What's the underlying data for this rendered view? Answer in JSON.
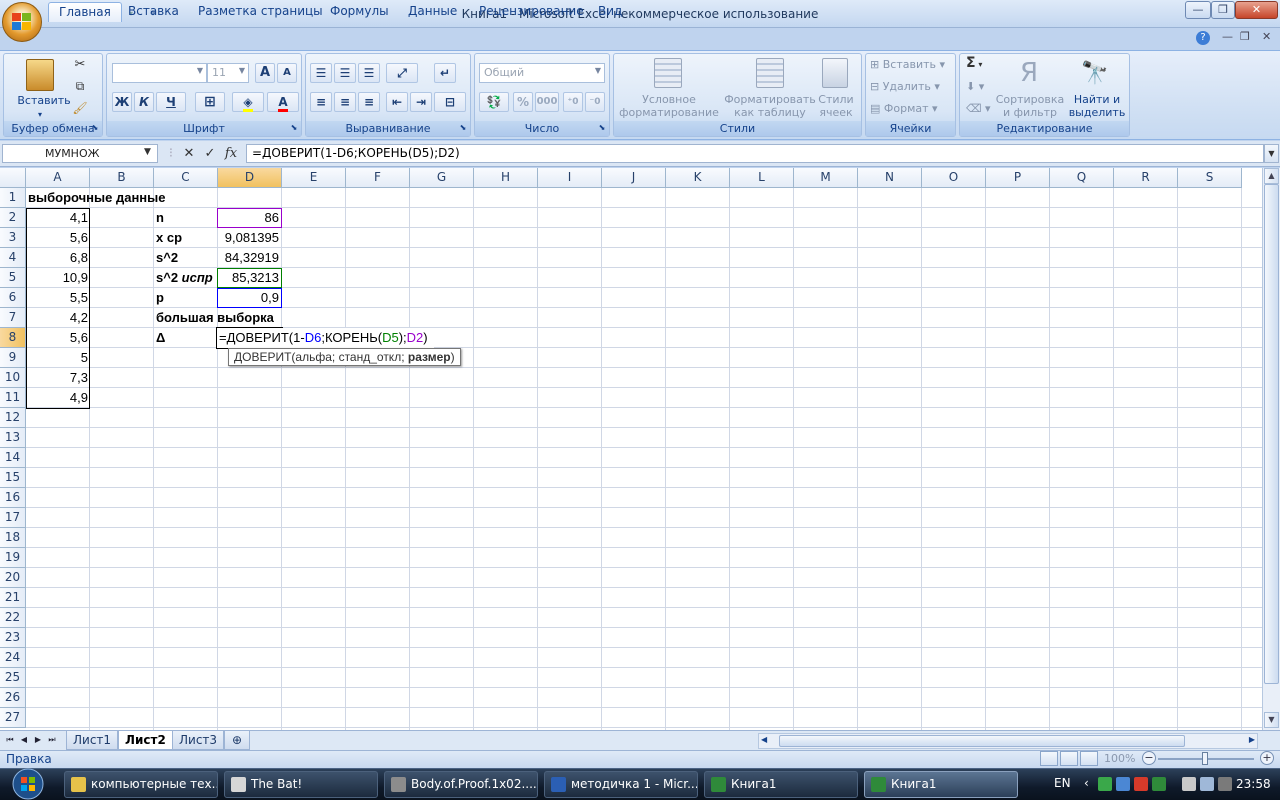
{
  "window": {
    "title": "Книга1 - Microsoft Excel некоммерческое использование"
  },
  "ribbon_tabs": [
    "Главная",
    "Вставка",
    "Разметка страницы",
    "Формулы",
    "Данные",
    "Рецензирование",
    "Вид"
  ],
  "ribbon": {
    "clipboard": {
      "paste_label": "Вставить",
      "group_label": "Буфер обмена"
    },
    "font": {
      "font_size": "11",
      "bold": "Ж",
      "italic": "К",
      "underline": "Ч",
      "grow": "A",
      "shrink": "A",
      "group_label": "Шрифт"
    },
    "alignment": {
      "group_label": "Выравнивание"
    },
    "number": {
      "format": "Общий",
      "percent": "%",
      "thousands": "000",
      "group_label": "Число"
    },
    "styles": {
      "conditional_line1": "Условное",
      "conditional_line2": "форматирование",
      "table_line1": "Форматировать",
      "table_line2": "как таблицу",
      "cell_styles_line1": "Стили",
      "cell_styles_line2": "ячеек",
      "group_label": "Стили"
    },
    "cells": {
      "insert": "Вставить",
      "delete": "Удалить",
      "format": "Формат",
      "group_label": "Ячейки"
    },
    "editing": {
      "sum": "Σ",
      "sort_line1": "Сортировка",
      "sort_line2": "и фильтр",
      "find_line1": "Найти и",
      "find_line2": "выделить",
      "group_label": "Редактирование"
    }
  },
  "formula_bar": {
    "name_box": "МУМНОЖ",
    "cancel": "✕",
    "enter": "✓",
    "fx": "fx",
    "formula": "=ДОВЕРИТ(1-D6;КОРЕНЬ(D5);D2)"
  },
  "columns": [
    "A",
    "B",
    "C",
    "D",
    "E",
    "F",
    "G",
    "H",
    "I",
    "J",
    "K",
    "L",
    "M",
    "N",
    "O",
    "P",
    "Q",
    "R",
    "S"
  ],
  "rows": [
    "1",
    "2",
    "3",
    "4",
    "5",
    "6",
    "7",
    "8",
    "9",
    "10",
    "11",
    "12",
    "13",
    "14",
    "15",
    "16",
    "17",
    "18",
    "19",
    "20",
    "21",
    "22",
    "23",
    "24",
    "25",
    "26",
    "27"
  ],
  "cells": {
    "A1": "выборочные данные",
    "A2": "4,1",
    "A3": "5,6",
    "A4": "6,8",
    "A5": "10,9",
    "A6": "5,5",
    "A7": "4,2",
    "A8": "5,6",
    "A9": "5",
    "A10": "7,3",
    "A11": "4,9",
    "C2": "n",
    "C3": "x ср",
    "C4": "s^2",
    "C5_part1": "s^2 ",
    "C5_part2": "испр",
    "C6": "p",
    "C7": "большая выборка",
    "C8": "Δ",
    "D2": "86",
    "D3": "9,081395",
    "D4": "84,32919",
    "D5": "85,3213",
    "D6": "0,9"
  },
  "edit_formula": {
    "p1": "=ДОВЕРИТ(1-",
    "ref1": "D6",
    "p2": ";КОРЕНЬ(",
    "ref2": "D5",
    "p3": ");",
    "ref3": "D2",
    "p4": ")"
  },
  "tooltip": {
    "text": "ДОВЕРИТ(альфа; станд_откл; ",
    "bold": "размер",
    "end": ")"
  },
  "ref_colors": {
    "D6": "#0000ff",
    "D5": "#008000",
    "D2": "#9900cc"
  },
  "sheets": [
    "Лист1",
    "Лист2",
    "Лист3"
  ],
  "active_sheet": "Лист2",
  "status": {
    "mode": "Правка",
    "zoom": "100%"
  },
  "taskbar": {
    "items": [
      "компьютерные тех...",
      "The Bat!",
      "Body.of.Proof.1x02....",
      "методичка 1 - Micr...",
      "Книга1",
      "Книга1"
    ],
    "language": "EN",
    "clock": "23:58"
  }
}
